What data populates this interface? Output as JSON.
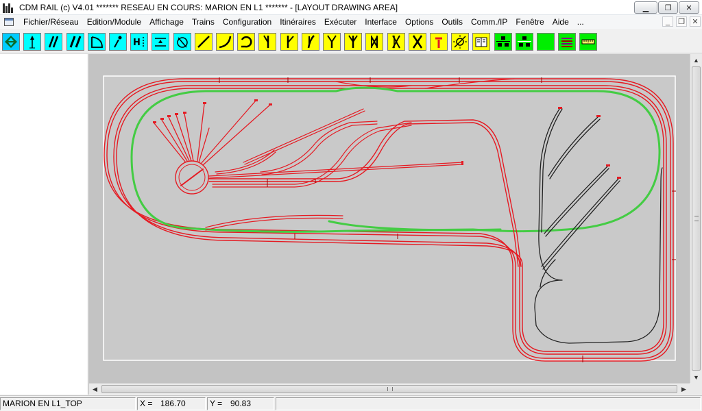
{
  "window": {
    "title": "CDM RAIL (c) V4.01     ******* RESEAU EN COURS: MARION EN L1 ******* - [LAYOUT DRAWING AREA]",
    "minimize_glyph": "▁",
    "maximize_glyph": "❐",
    "close_glyph": "✕"
  },
  "menu": {
    "items": [
      "Fichier/Réseau",
      "Edition/Module",
      "Affichage",
      "Trains",
      "Configuration",
      "Itinéraires",
      "Exécuter",
      "Interface",
      "Options",
      "Outils",
      "Comm./IP",
      "Fenêtre",
      "Aide",
      "..."
    ],
    "mdi_minimize": "_",
    "mdi_restore": "❐",
    "mdi_close": "✕"
  },
  "toolbar": {
    "tools": [
      {
        "name": "navigate-tool",
        "icon": "diamond-arrows-icon",
        "bg": "#00ccff"
      },
      {
        "name": "signal-tool",
        "icon": "signal-arrow-icon",
        "bg": "#00ffff"
      },
      {
        "name": "double-slash-tool",
        "icon": "double-slash-icon",
        "bg": "#00ffff"
      },
      {
        "name": "double-italic-tool",
        "icon": "double-italic-icon",
        "bg": "#00ffff"
      },
      {
        "name": "quarter-curve-tool",
        "icon": "quarter-curve-icon",
        "bg": "#00ffff"
      },
      {
        "name": "segment-tool",
        "icon": "dot-line-icon",
        "bg": "#00ffff"
      },
      {
        "name": "height-tool",
        "icon": "height-icon",
        "bg": "#00ffff"
      },
      {
        "name": "platform-tool",
        "icon": "platform-icon",
        "bg": "#00ffff"
      },
      {
        "name": "turntable-tool",
        "icon": "turntable-icon",
        "bg": "#00ffff"
      },
      {
        "name": "straight-track-tool",
        "icon": "straight-track-icon",
        "bg": "#ffff00"
      },
      {
        "name": "curve-track-tool",
        "icon": "curve-track-icon",
        "bg": "#ffff00"
      },
      {
        "name": "loop-track-tool",
        "icon": "loop-track-icon",
        "bg": "#ffff00"
      },
      {
        "name": "left-turnout-tool",
        "icon": "left-turnout-icon",
        "bg": "#ffff00"
      },
      {
        "name": "right-turnout-tool",
        "icon": "right-turnout-icon",
        "bg": "#ffff00"
      },
      {
        "name": "curved-turnout-tool",
        "icon": "curved-turnout-icon",
        "bg": "#ffff00"
      },
      {
        "name": "wye-turnout-tool",
        "icon": "wye-turnout-icon",
        "bg": "#ffff00"
      },
      {
        "name": "three-way-turnout-tool",
        "icon": "three-way-turnout-icon",
        "bg": "#ffff00"
      },
      {
        "name": "double-slip-tool",
        "icon": "double-slip-icon",
        "bg": "#ffff00"
      },
      {
        "name": "single-slip-tool",
        "icon": "single-slip-icon",
        "bg": "#ffff00"
      },
      {
        "name": "crossing-tool",
        "icon": "crossing-icon",
        "bg": "#ffff00"
      },
      {
        "name": "buffer-stop-tool",
        "icon": "buffer-stop-icon",
        "bg": "#ffff00"
      },
      {
        "name": "wizard-tool",
        "icon": "sun-wand-icon",
        "bg": "#ffff00"
      },
      {
        "name": "catalog-tool",
        "icon": "book-icon",
        "bg": "#ffff00"
      },
      {
        "name": "module-tool",
        "icon": "module-blocks-icon",
        "bg": "#00ee00"
      },
      {
        "name": "module-edit-tool",
        "icon": "module-edit-icon",
        "bg": "#00ee00"
      },
      {
        "name": "green-block-tool",
        "icon": "green-block-icon",
        "bg": "#00ee00"
      },
      {
        "name": "layers-tool",
        "icon": "layers-icon",
        "bg": "#00ee00"
      },
      {
        "name": "ruler-tool",
        "icon": "ruler-icon",
        "bg": "#00ee00"
      }
    ]
  },
  "colors": {
    "track_red": "#e51b23",
    "track_green": "#44cc44",
    "track_black": "#222222",
    "canvas_bg": "#c3c3c3",
    "layout_bg": "#c9c9c9"
  },
  "status": {
    "module_name": "MARION EN L1_TOP",
    "x_label": "X =",
    "x_value": "186.70",
    "y_label": "Y =",
    "y_value": "90.83"
  }
}
